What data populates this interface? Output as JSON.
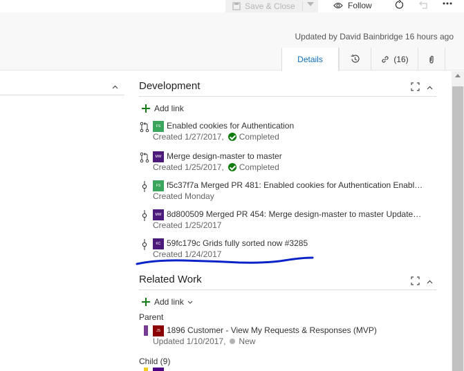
{
  "toolbar": {
    "save_close_label": "Save & Close",
    "follow_label": "Follow"
  },
  "header": {
    "updated_text": "Updated by David Bainbridge 16 hours ago"
  },
  "tabs": {
    "details": "Details",
    "links_count": "(16)"
  },
  "development": {
    "title": "Development",
    "add_link_label": "Add link",
    "items": [
      {
        "avatar": "FS",
        "avatar_color": "#3aa55d",
        "title": "Enabled cookies for Authentication",
        "created": "Created 1/27/2017,",
        "status": "Completed",
        "type_icon": "pull-request-icon"
      },
      {
        "avatar": "MW",
        "avatar_color": "#4b1a7a",
        "title": "Merge design-master to master",
        "created": "Created 1/25/2017,",
        "status": "Completed",
        "type_icon": "pull-request-icon"
      },
      {
        "avatar": "FS",
        "avatar_color": "#3aa55d",
        "title": "f5c37f7a Merged PR 481: Enabled cookies for Authentication Enable...",
        "created": "Created Monday",
        "type_icon": "commit-icon"
      },
      {
        "avatar": "MW",
        "avatar_color": "#4b1a7a",
        "title": "8d800509 Merged PR 454: Merge design-master to master Updates ...",
        "created": "Created 1/25/2017",
        "type_icon": "commit-icon"
      },
      {
        "avatar": "KC",
        "avatar_color": "#4b1a7a",
        "title": "59fc179c Grids fully sorted now #3285",
        "created": "Created 1/24/2017",
        "type_icon": "commit-icon"
      }
    ]
  },
  "related_work": {
    "title": "Related Work",
    "add_link_label": "Add link",
    "parent_label": "Parent",
    "parent_item": {
      "avatar": "JS",
      "title": "1896 Customer - View My Requests & Responses (MVP)",
      "updated": "Updated 1/10/2017,",
      "state": "New"
    },
    "child_label": "Child (9)"
  },
  "colors": {
    "accent": "#106ebe",
    "success": "#107c10",
    "annotation": "#0a23c9"
  }
}
